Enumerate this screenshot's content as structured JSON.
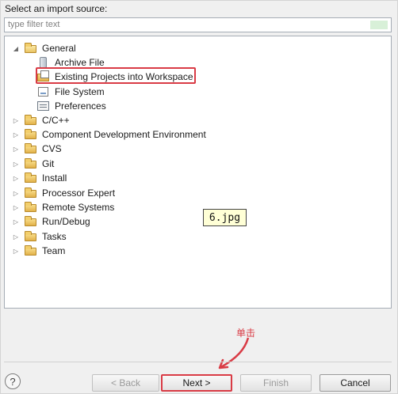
{
  "dialog": {
    "heading": "Select an import source:",
    "filter_placeholder": "type filter text"
  },
  "tree": {
    "general": {
      "label": "General",
      "expanded": true,
      "children": [
        {
          "label": "Archive File",
          "icon": "archive-file-icon"
        },
        {
          "label": "Existing Projects into Workspace",
          "icon": "existing-projects-icon",
          "highlighted": true
        },
        {
          "label": "File System",
          "icon": "file-system-icon"
        },
        {
          "label": "Preferences",
          "icon": "preferences-icon"
        }
      ]
    },
    "categories": [
      {
        "label": "C/C++"
      },
      {
        "label": "Component Development Environment"
      },
      {
        "label": "CVS"
      },
      {
        "label": "Git"
      },
      {
        "label": "Install"
      },
      {
        "label": "Processor Expert"
      },
      {
        "label": "Remote Systems"
      },
      {
        "label": "Run/Debug"
      },
      {
        "label": "Tasks"
      },
      {
        "label": "Team"
      }
    ]
  },
  "annotation": {
    "image_label": "6.jpg",
    "callout": "单击"
  },
  "buttons": {
    "help": "?",
    "back": "< Back",
    "next": "Next >",
    "finish": "Finish",
    "cancel": "Cancel"
  },
  "colors": {
    "highlight": "#d93b45"
  }
}
